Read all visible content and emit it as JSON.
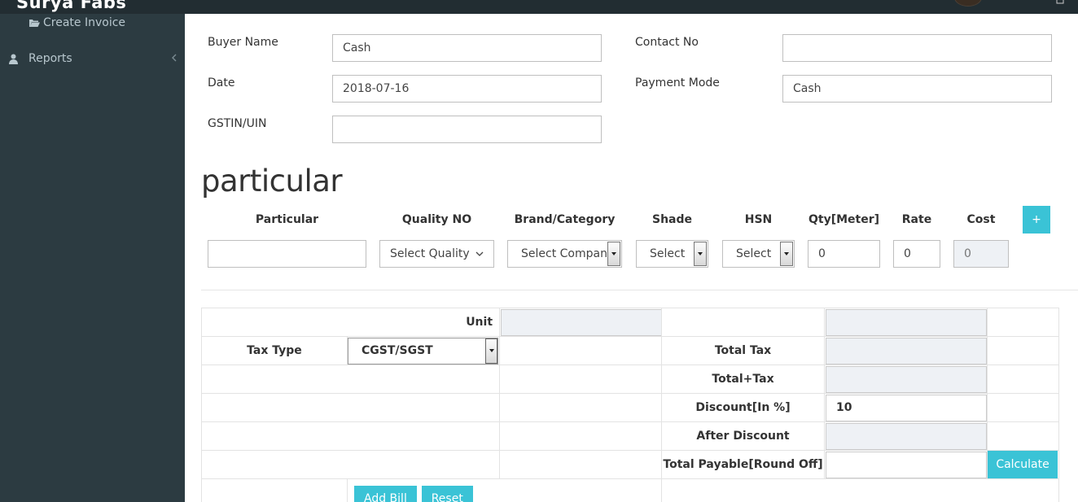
{
  "app": {
    "brand": "Surya Fabs"
  },
  "sidebar": {
    "sub_item": "Create Invoice",
    "items": [
      {
        "label": "Reports",
        "icon": "user-icon"
      }
    ]
  },
  "form": {
    "buyer_name": {
      "label": "Buyer Name",
      "value": "Cash"
    },
    "contact_no": {
      "label": "Contact No",
      "value": ""
    },
    "date": {
      "label": "Date",
      "value": "2018-07-16"
    },
    "payment_mode": {
      "label": "Payment Mode",
      "value": "Cash"
    },
    "gstin": {
      "label": "GSTIN/UIN",
      "value": ""
    }
  },
  "particular": {
    "title": "particular",
    "columns": [
      "Particular",
      "Quality NO",
      "Brand/Category",
      "Shade",
      "HSN",
      "Qty[Meter]",
      "Rate",
      "Cost"
    ],
    "add_label": "+",
    "row": {
      "particular": "",
      "quality": "Select Quality",
      "brand": "Select Company",
      "shade": "Select",
      "hsn": "Select",
      "qty": "0",
      "rate": "0",
      "cost": "0"
    }
  },
  "summary": {
    "unit_label": "Unit",
    "unit_value": "",
    "tax_type_label": "Tax Type",
    "tax_type_value": "CGST/SGST",
    "total_tax_label": "Total Tax",
    "total_plus_tax_label": "Total+Tax",
    "discount_label": "Discount[In %]",
    "discount_value": "10",
    "after_discount_label": "After Discount",
    "total_payable_label": "Total Payable[Round Off]",
    "calculate_label": "Calculate",
    "add_bill_label": "Add Bill",
    "reset_label": "Reset"
  },
  "colors": {
    "accent": "#3ac3d6",
    "sidebar": "#2c3b41",
    "topbar": "#222d32"
  }
}
